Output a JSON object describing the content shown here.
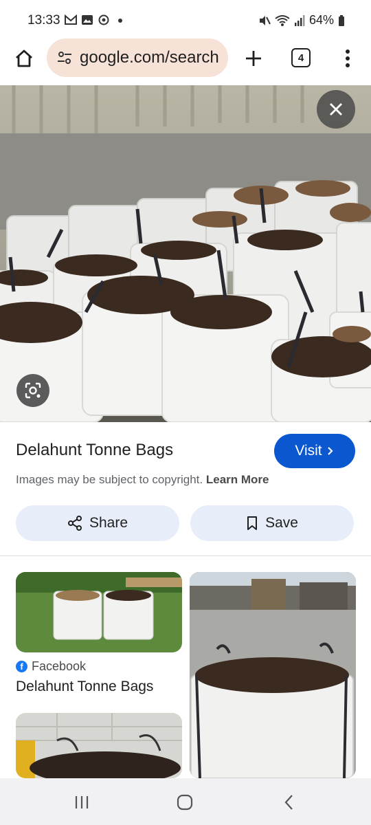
{
  "status_bar": {
    "time": "13:33",
    "left_icons": [
      "gmail-icon",
      "gallery-icon",
      "sync-icon",
      "dot-icon"
    ],
    "battery": "64%",
    "right_icons": [
      "mute-icon",
      "wifi-icon",
      "signal-icon",
      "battery-icon"
    ]
  },
  "browser": {
    "url": "google.com/search",
    "tab_count": "4"
  },
  "viewer": {
    "title": "Delahunt Tonne Bags",
    "visit_label": "Visit",
    "copyright_text": "Images may be subject to copyright.",
    "learn_more": "Learn More",
    "share_label": "Share",
    "save_label": "Save"
  },
  "results": [
    {
      "source": "Facebook",
      "title": "Delahunt Tonne Bags"
    }
  ],
  "colors": {
    "url_pill": "#f7e2d8",
    "visit_button": "#0b57d0",
    "action_button": "#e8eef9",
    "nav_bar": "#f1f1f3"
  }
}
